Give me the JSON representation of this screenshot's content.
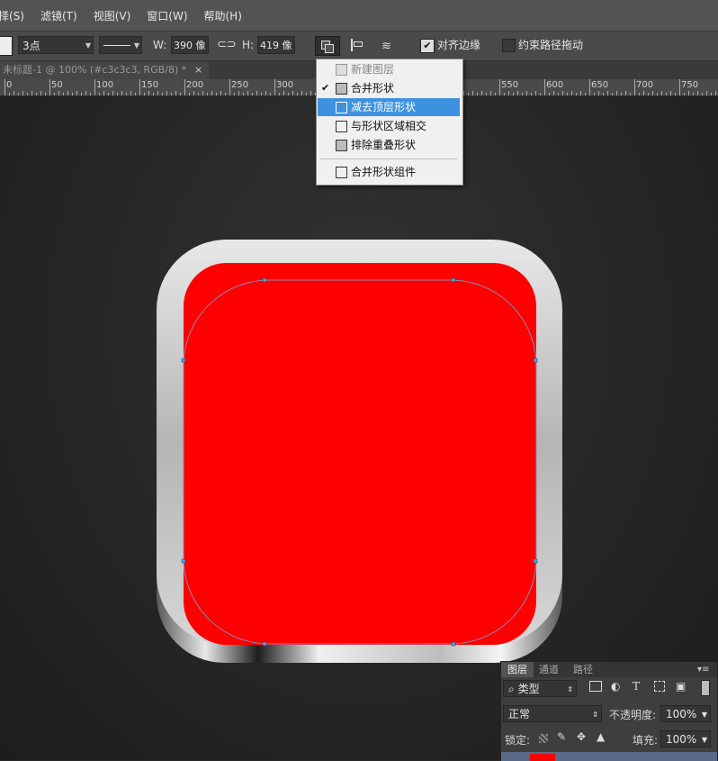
{
  "menubar": {
    "items": [
      "择(S)",
      "滤镜(T)",
      "视图(V)",
      "窗口(W)",
      "帮助(H)"
    ]
  },
  "options": {
    "stroke_size": "3点",
    "w_label": "W:",
    "w_value": "390 像",
    "h_label": "H:",
    "h_value": "419 像",
    "align_edges": "对齐边缘",
    "constrain_path": "约束路径拖动"
  },
  "document": {
    "tab_title": "未标题-1 @ 100% (#c3c3c3, RGB/8) *",
    "close": "×"
  },
  "ruler": {
    "labels": [
      "0",
      "50",
      "100",
      "150",
      "200",
      "250",
      "300",
      "550",
      "600",
      "650",
      "700",
      "750"
    ]
  },
  "path_ops_menu": {
    "items": [
      {
        "label": "新建图层",
        "checked": false,
        "highlighted": false,
        "disabled": true
      },
      {
        "label": "合并形状",
        "checked": true,
        "highlighted": false,
        "disabled": false
      },
      {
        "label": "减去顶层形状",
        "checked": false,
        "highlighted": true,
        "disabled": false
      },
      {
        "label": "与形状区域相交",
        "checked": false,
        "highlighted": false,
        "disabled": false
      },
      {
        "label": "排除重叠形状",
        "checked": false,
        "highlighted": false,
        "disabled": false
      },
      {
        "label": "合并形状组件",
        "checked": false,
        "highlighted": false,
        "disabled": false
      }
    ],
    "checkmark": "✔"
  },
  "layers_panel": {
    "tabs": [
      "图层",
      "通道",
      "路径"
    ],
    "filter_kind": "类型",
    "blend_mode": "正常",
    "opacity_label": "不透明度:",
    "opacity_value": "100%",
    "lock_label": "锁定:",
    "fill_label": "填充:",
    "fill_value": "100%"
  },
  "colors": {
    "icon_red": "#ff0000",
    "highlight": "#3d92e0",
    "frame": "#c3c3c3"
  }
}
